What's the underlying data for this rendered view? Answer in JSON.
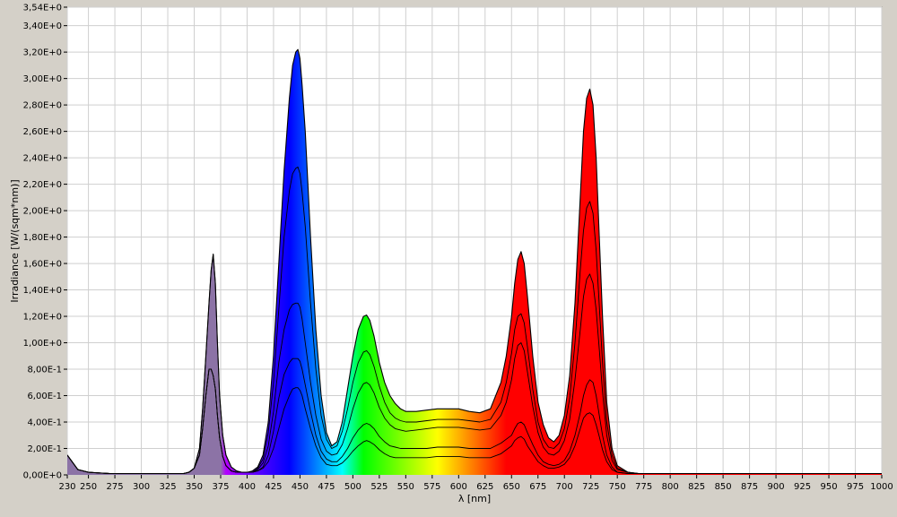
{
  "chart_data": {
    "type": "area",
    "title": "",
    "xlabel": "λ [nm]",
    "ylabel": "Irradiance [W/(sqm*nm)]",
    "xlim": [
      230,
      1000
    ],
    "ylim": [
      0,
      3.54
    ],
    "grid": true,
    "x_ticks": [
      {
        "value": 230,
        "label": "230"
      },
      {
        "value": 250,
        "label": "250"
      },
      {
        "value": 275,
        "label": "275"
      },
      {
        "value": 300,
        "label": "300"
      },
      {
        "value": 325,
        "label": "325"
      },
      {
        "value": 350,
        "label": "350"
      },
      {
        "value": 375,
        "label": "375"
      },
      {
        "value": 400,
        "label": "400"
      },
      {
        "value": 425,
        "label": "425"
      },
      {
        "value": 450,
        "label": "450"
      },
      {
        "value": 475,
        "label": "475"
      },
      {
        "value": 500,
        "label": "500"
      },
      {
        "value": 525,
        "label": "525"
      },
      {
        "value": 550,
        "label": "550"
      },
      {
        "value": 575,
        "label": "575"
      },
      {
        "value": 600,
        "label": "600"
      },
      {
        "value": 625,
        "label": "625"
      },
      {
        "value": 650,
        "label": "650"
      },
      {
        "value": 675,
        "label": "675"
      },
      {
        "value": 700,
        "label": "700"
      },
      {
        "value": 725,
        "label": "725"
      },
      {
        "value": 750,
        "label": "750"
      },
      {
        "value": 775,
        "label": "775"
      },
      {
        "value": 800,
        "label": "800"
      },
      {
        "value": 825,
        "label": "825"
      },
      {
        "value": 850,
        "label": "850"
      },
      {
        "value": 875,
        "label": "875"
      },
      {
        "value": 900,
        "label": "900"
      },
      {
        "value": 925,
        "label": "925"
      },
      {
        "value": 950,
        "label": "950"
      },
      {
        "value": 975,
        "label": "975"
      },
      {
        "value": 1000,
        "label": "1000"
      }
    ],
    "y_ticks": [
      {
        "value": 0.0,
        "label": "0,00E+0"
      },
      {
        "value": 0.2,
        "label": "2,00E-1"
      },
      {
        "value": 0.4,
        "label": "4,00E-1"
      },
      {
        "value": 0.6,
        "label": "6,00E-1"
      },
      {
        "value": 0.8,
        "label": "8,00E-1"
      },
      {
        "value": 1.0,
        "label": "1,00E+0"
      },
      {
        "value": 1.2,
        "label": "1,20E+0"
      },
      {
        "value": 1.4,
        "label": "1,40E+0"
      },
      {
        "value": 1.6,
        "label": "1,60E+0"
      },
      {
        "value": 1.8,
        "label": "1,80E+0"
      },
      {
        "value": 2.0,
        "label": "2,00E+0"
      },
      {
        "value": 2.2,
        "label": "2,20E+0"
      },
      {
        "value": 2.4,
        "label": "2,40E+0"
      },
      {
        "value": 2.6,
        "label": "2,60E+0"
      },
      {
        "value": 2.8,
        "label": "2,80E+0"
      },
      {
        "value": 3.0,
        "label": "3,00E+0"
      },
      {
        "value": 3.2,
        "label": "3,20E+0"
      },
      {
        "value": 3.4,
        "label": "3,40E+0"
      },
      {
        "value": 3.54,
        "label": "3,54E+0"
      }
    ],
    "x": [
      230,
      240,
      250,
      260,
      270,
      280,
      290,
      300,
      310,
      320,
      330,
      340,
      345,
      350,
      355,
      358,
      361,
      364,
      366,
      368,
      370,
      372,
      374,
      377,
      380,
      385,
      390,
      395,
      400,
      405,
      410,
      415,
      420,
      425,
      430,
      435,
      440,
      443,
      446,
      448,
      450,
      452,
      455,
      460,
      465,
      470,
      475,
      480,
      485,
      490,
      495,
      500,
      505,
      510,
      513,
      516,
      520,
      525,
      530,
      535,
      540,
      545,
      550,
      560,
      570,
      580,
      590,
      600,
      610,
      620,
      630,
      640,
      645,
      650,
      653,
      656,
      659,
      662,
      665,
      670,
      675,
      680,
      685,
      690,
      695,
      700,
      705,
      710,
      715,
      718,
      721,
      724,
      727,
      730,
      733,
      736,
      740,
      745,
      750,
      760,
      770,
      780,
      800,
      850,
      900,
      950,
      1000
    ],
    "series": [
      {
        "values": [
          0.15,
          0.04,
          0.02,
          0.015,
          0.01,
          0.01,
          0.01,
          0.01,
          0.01,
          0.01,
          0.01,
          0.01,
          0.02,
          0.05,
          0.2,
          0.5,
          0.9,
          1.3,
          1.55,
          1.67,
          1.45,
          1.0,
          0.6,
          0.3,
          0.15,
          0.06,
          0.03,
          0.02,
          0.02,
          0.03,
          0.06,
          0.15,
          0.4,
          0.9,
          1.6,
          2.3,
          2.85,
          3.1,
          3.2,
          3.22,
          3.15,
          2.95,
          2.6,
          1.8,
          1.1,
          0.6,
          0.32,
          0.22,
          0.25,
          0.4,
          0.65,
          0.9,
          1.1,
          1.2,
          1.21,
          1.17,
          1.05,
          0.85,
          0.7,
          0.6,
          0.54,
          0.5,
          0.48,
          0.48,
          0.49,
          0.5,
          0.5,
          0.5,
          0.48,
          0.47,
          0.5,
          0.7,
          0.9,
          1.2,
          1.45,
          1.63,
          1.69,
          1.6,
          1.35,
          0.9,
          0.55,
          0.38,
          0.28,
          0.25,
          0.3,
          0.45,
          0.75,
          1.3,
          2.1,
          2.6,
          2.85,
          2.92,
          2.8,
          2.4,
          1.8,
          1.2,
          0.55,
          0.2,
          0.07,
          0.02,
          0.01,
          0.01,
          0.01,
          0.01,
          0.01,
          0.01,
          0.01
        ]
      },
      {
        "values": [
          0.15,
          0.04,
          0.02,
          0.015,
          0.01,
          0.01,
          0.01,
          0.01,
          0.01,
          0.01,
          0.01,
          0.01,
          0.02,
          0.05,
          0.2,
          0.5,
          0.9,
          1.3,
          1.55,
          1.67,
          1.45,
          1.0,
          0.6,
          0.3,
          0.15,
          0.06,
          0.03,
          0.02,
          0.02,
          0.02,
          0.05,
          0.12,
          0.32,
          0.7,
          1.25,
          1.8,
          2.15,
          2.28,
          2.32,
          2.33,
          2.28,
          2.14,
          1.88,
          1.3,
          0.8,
          0.45,
          0.27,
          0.2,
          0.22,
          0.33,
          0.5,
          0.7,
          0.85,
          0.93,
          0.94,
          0.91,
          0.82,
          0.67,
          0.55,
          0.47,
          0.43,
          0.41,
          0.4,
          0.4,
          0.41,
          0.42,
          0.42,
          0.42,
          0.41,
          0.4,
          0.42,
          0.55,
          0.7,
          0.92,
          1.1,
          1.2,
          1.22,
          1.15,
          0.97,
          0.65,
          0.4,
          0.27,
          0.21,
          0.2,
          0.24,
          0.35,
          0.58,
          1.0,
          1.55,
          1.85,
          2.02,
          2.07,
          1.98,
          1.7,
          1.28,
          0.85,
          0.4,
          0.15,
          0.05,
          0.02,
          0.01,
          0.01,
          0.01,
          0.01,
          0.01,
          0.01,
          0.01
        ]
      },
      {
        "values": [
          0.15,
          0.04,
          0.02,
          0.015,
          0.01,
          0.01,
          0.01,
          0.01,
          0.01,
          0.01,
          0.01,
          0.01,
          0.02,
          0.05,
          0.15,
          0.35,
          0.6,
          0.8,
          0.8,
          0.75,
          0.65,
          0.45,
          0.28,
          0.14,
          0.07,
          0.03,
          0.02,
          0.02,
          0.02,
          0.02,
          0.04,
          0.09,
          0.22,
          0.48,
          0.85,
          1.1,
          1.25,
          1.29,
          1.3,
          1.3,
          1.27,
          1.18,
          1.0,
          0.7,
          0.45,
          0.27,
          0.18,
          0.15,
          0.16,
          0.23,
          0.35,
          0.5,
          0.62,
          0.69,
          0.7,
          0.68,
          0.62,
          0.51,
          0.43,
          0.38,
          0.35,
          0.34,
          0.33,
          0.34,
          0.35,
          0.36,
          0.36,
          0.36,
          0.35,
          0.34,
          0.35,
          0.45,
          0.55,
          0.72,
          0.88,
          0.98,
          1.0,
          0.94,
          0.78,
          0.52,
          0.32,
          0.21,
          0.16,
          0.15,
          0.18,
          0.26,
          0.42,
          0.72,
          1.1,
          1.35,
          1.48,
          1.52,
          1.45,
          1.25,
          0.95,
          0.63,
          0.3,
          0.11,
          0.04,
          0.02,
          0.01,
          0.01,
          0.01,
          0.01,
          0.01,
          0.01,
          0.01
        ]
      },
      {
        "values": [
          0.15,
          0.04,
          0.02,
          0.015,
          0.01,
          0.01,
          0.01,
          0.01,
          0.01,
          0.01,
          0.01,
          0.01,
          0.02,
          0.05,
          0.15,
          0.35,
          0.6,
          0.8,
          0.8,
          0.75,
          0.65,
          0.45,
          0.28,
          0.14,
          0.07,
          0.03,
          0.02,
          0.02,
          0.02,
          0.02,
          0.03,
          0.06,
          0.15,
          0.33,
          0.58,
          0.76,
          0.85,
          0.88,
          0.88,
          0.88,
          0.86,
          0.8,
          0.68,
          0.48,
          0.3,
          0.18,
          0.12,
          0.1,
          0.1,
          0.14,
          0.2,
          0.28,
          0.34,
          0.38,
          0.39,
          0.38,
          0.35,
          0.29,
          0.25,
          0.22,
          0.21,
          0.2,
          0.2,
          0.2,
          0.2,
          0.21,
          0.21,
          0.21,
          0.2,
          0.2,
          0.2,
          0.24,
          0.27,
          0.3,
          0.35,
          0.39,
          0.4,
          0.38,
          0.32,
          0.23,
          0.15,
          0.1,
          0.08,
          0.07,
          0.08,
          0.11,
          0.18,
          0.3,
          0.47,
          0.6,
          0.68,
          0.72,
          0.7,
          0.6,
          0.45,
          0.3,
          0.15,
          0.06,
          0.02,
          0.01,
          0.01,
          0.01,
          0.01,
          0.01,
          0.01,
          0.01,
          0.01
        ]
      },
      {
        "values": [
          0.15,
          0.04,
          0.02,
          0.015,
          0.01,
          0.01,
          0.01,
          0.01,
          0.01,
          0.01,
          0.01,
          0.01,
          0.02,
          0.05,
          0.15,
          0.35,
          0.6,
          0.8,
          0.8,
          0.75,
          0.65,
          0.45,
          0.28,
          0.14,
          0.07,
          0.03,
          0.02,
          0.02,
          0.02,
          0.02,
          0.03,
          0.05,
          0.1,
          0.2,
          0.35,
          0.5,
          0.6,
          0.65,
          0.66,
          0.66,
          0.64,
          0.6,
          0.5,
          0.35,
          0.22,
          0.13,
          0.08,
          0.07,
          0.07,
          0.09,
          0.13,
          0.18,
          0.22,
          0.25,
          0.26,
          0.25,
          0.23,
          0.19,
          0.16,
          0.14,
          0.13,
          0.13,
          0.13,
          0.13,
          0.13,
          0.14,
          0.14,
          0.14,
          0.13,
          0.13,
          0.13,
          0.16,
          0.19,
          0.22,
          0.26,
          0.28,
          0.29,
          0.27,
          0.22,
          0.16,
          0.1,
          0.07,
          0.05,
          0.05,
          0.06,
          0.08,
          0.13,
          0.22,
          0.35,
          0.43,
          0.46,
          0.47,
          0.45,
          0.38,
          0.29,
          0.19,
          0.1,
          0.04,
          0.02,
          0.01,
          0.01,
          0.01,
          0.01,
          0.01,
          0.01,
          0.01,
          0.01
        ]
      }
    ]
  }
}
